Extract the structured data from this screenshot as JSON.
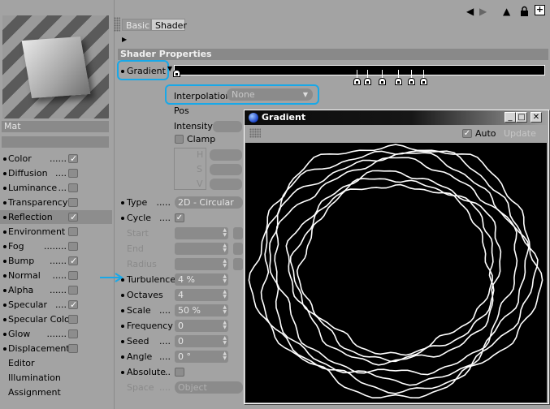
{
  "tabs": [
    "Basic",
    "Shader"
  ],
  "section_title": "Shader Properties",
  "gradient_label": "Gradient",
  "material_name": "Mat",
  "channels": [
    {
      "label": "Color",
      "dots": "......",
      "checked": true
    },
    {
      "label": "Diffusion",
      "dots": "....",
      "checked": false
    },
    {
      "label": "Luminance",
      "dots": "...",
      "checked": false
    },
    {
      "label": "Transparency",
      "dots": "",
      "checked": false
    },
    {
      "label": "Reflection",
      "dots": "",
      "checked": true
    },
    {
      "label": "Environment",
      "dots": "",
      "checked": false
    },
    {
      "label": "Fog",
      "dots": "........",
      "checked": false
    },
    {
      "label": "Bump",
      "dots": "......",
      "checked": true
    },
    {
      "label": "Normal",
      "dots": ".....",
      "checked": false
    },
    {
      "label": "Alpha",
      "dots": "......",
      "checked": false
    },
    {
      "label": "Specular",
      "dots": "....",
      "checked": true
    },
    {
      "label": "Specular Color",
      "dots": "",
      "checked": false
    },
    {
      "label": "Glow",
      "dots": ".......",
      "checked": false
    },
    {
      "label": "Displacement",
      "dots": "",
      "checked": false
    }
  ],
  "extra_items": [
    "Editor",
    "Illumination",
    "Assignment"
  ],
  "interpolation": {
    "label": "Interpolation",
    "value": "None"
  },
  "knot_props": {
    "pos": "Pos",
    "intensity": "Intensity",
    "clamp": "Clamp",
    "h": "H",
    "s": "S",
    "v": "V"
  },
  "props": [
    {
      "label": "Type",
      "dots": ".....",
      "value": "2D - Circular",
      "kind": "dropdown",
      "enabled": true
    },
    {
      "label": "Cycle",
      "dots": "....",
      "value": "",
      "kind": "checkbox",
      "checked": true,
      "enabled": true
    },
    {
      "label": "Start",
      "dots": "",
      "value": "",
      "kind": "field",
      "enabled": false
    },
    {
      "label": "End",
      "dots": "",
      "value": "",
      "kind": "field",
      "enabled": false
    },
    {
      "label": "Radius",
      "dots": "",
      "value": "",
      "kind": "field",
      "enabled": false
    },
    {
      "label": "Turbulence",
      "dots": "",
      "value": "4 %",
      "kind": "field",
      "enabled": true
    },
    {
      "label": "Octaves",
      "dots": "",
      "value": "4",
      "kind": "field",
      "enabled": true
    },
    {
      "label": "Scale",
      "dots": "....",
      "value": "50 %",
      "kind": "field",
      "enabled": true
    },
    {
      "label": "Frequency",
      "dots": "",
      "value": "0",
      "kind": "field",
      "enabled": true
    },
    {
      "label": "Seed",
      "dots": "....",
      "value": "0",
      "kind": "field",
      "enabled": true
    },
    {
      "label": "Angle",
      "dots": "....",
      "value": "0 °",
      "kind": "field",
      "enabled": true
    },
    {
      "label": "Absolute",
      "dots": "..",
      "value": "",
      "kind": "checkbox",
      "checked": false,
      "enabled": true
    },
    {
      "label": "Space",
      "dots": "....",
      "value": "Object",
      "kind": "dropdown",
      "enabled": false
    }
  ],
  "gradient_window": {
    "title": "Gradient",
    "auto_label": "Auto",
    "auto_checked": true,
    "update_label": "Update"
  },
  "colors": {
    "highlight": "#19a8e8",
    "panel_bg": "#a3a3a3",
    "field_bg": "#8b8b8b"
  },
  "icons": [
    "arrow-left-icon",
    "arrow-right-icon",
    "up-triangle-icon",
    "lock-icon",
    "plus-icon",
    "sphere-icon"
  ]
}
